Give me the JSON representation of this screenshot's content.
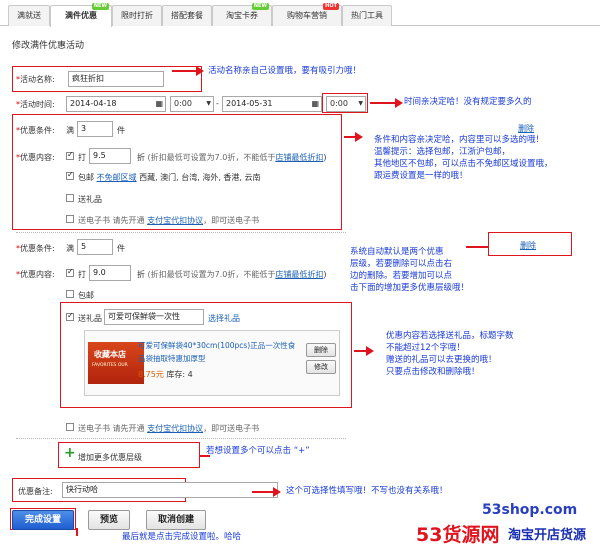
{
  "tabs": [
    {
      "label": "满就送"
    },
    {
      "label": "满件优惠",
      "badge": "NEW"
    },
    {
      "label": "限时打折"
    },
    {
      "label": "搭配套餐"
    },
    {
      "label": "淘宝卡券",
      "badge": "NEW"
    },
    {
      "label": "购物车营销",
      "badge": "HOT"
    },
    {
      "label": "热门工具"
    }
  ],
  "page_title": "修改满件优惠活动",
  "form": {
    "name_label": "活动名称:",
    "name_value": "疯狂折扣",
    "time_label": "活动时间:",
    "start_date": "2014-04-18",
    "start_time": "0:00",
    "dash": "-",
    "end_date": "2014-05-31",
    "end_time": "0:00",
    "required_mark": "*",
    "cond_label": "优惠条件:",
    "content_label": "优惠内容:",
    "full": "满",
    "piece": "件",
    "level1": {
      "count": "3",
      "discount": "9.5",
      "discount_unit": "折",
      "discount_hint": "(折扣最低可设置为7.0折，不能低于",
      "discount_link": "店铺最低折扣",
      "discount_hint_end": ")",
      "delete": "删除",
      "ship_label": "包邮",
      "ship_link": "不免邮区域",
      "ship_regions": "西藏, 澳门, 台湾, 海外, 香港, 云南",
      "gift_label": "送礼品",
      "ebook_label": "送电子书 请先开通",
      "ebook_link": "支付宝代扣协议",
      "ebook_end": "，即可送电子书"
    },
    "level2": {
      "count": "5",
      "discount": "9.0",
      "discount_unit": "折",
      "discount_hint": "(折扣最低可设置为7.0折，不能低于",
      "discount_link": "店铺最低折扣",
      "discount_hint_end": ")",
      "delete": "删除",
      "ship_label": "包邮",
      "gift_label": "送礼品",
      "gift_name": "可爱可保鲜袋一次性",
      "gift_select": "选择礼品",
      "gift_product_title": "可爱可保鲜袋40*30cm(100pcs)正品一次性食品袋抽取特惠加厚型",
      "gift_price": "8.75元",
      "gift_stock": "库存: 4",
      "gift_thumb_text": "收藏本店",
      "gift_thumb_sub": "FAVORITES OUR",
      "gift_delete": "删除",
      "gift_edit": "修改",
      "ebook_label": "送电子书 请先开通",
      "ebook_link": "支付宝代扣协议",
      "ebook_end": "，即可送电子书"
    },
    "add_level": "增加更多优惠层级",
    "remark_label": "优惠备注:",
    "remark_value": "快行动哈"
  },
  "buttons": {
    "finish": "完成设置",
    "preview": "预览",
    "cancel": "取消创建"
  },
  "notes": {
    "n1": "活动名称亲自己设置哦，要有吸引力哦！",
    "n2": "时间亲决定哈！没有规定要多久的",
    "n3": [
      "条件和内容亲决定哈，内容里可以多选的哦！",
      "温馨提示：选择包邮，江浙沪包邮，",
      "其他地区不包邮，可以点击不免邮区域设置哦，",
      "跟运费设置是一样的哦！"
    ],
    "n4": [
      "系统自动默认是两个优惠",
      "层级，若要删除可以点击右",
      "边的删除。若要增加可以点",
      "击下面的增加更多优惠层级哦！"
    ],
    "n5": [
      "优惠内容若选择送礼品，标题字数",
      "不能超过12个字哦！",
      "赠送的礼品可以去更换的哦！",
      "只要点击修改和删除哦！"
    ],
    "n6": "若想设置多个可以点击 “+”",
    "n7": "这个可选择性填写哦！不写也没有关系哦！",
    "n8": "最后就是点击完成设置啦。哈哈"
  },
  "watermark": {
    "site": "53shop.com",
    "brand": "53货源网",
    "slogan": "淘宝开店货源"
  },
  "colors": {
    "accent": "#1a5fb4",
    "annotation_red": "#e0141e",
    "annotation_blue": "#1a3bd6",
    "price": "#e05a00"
  }
}
